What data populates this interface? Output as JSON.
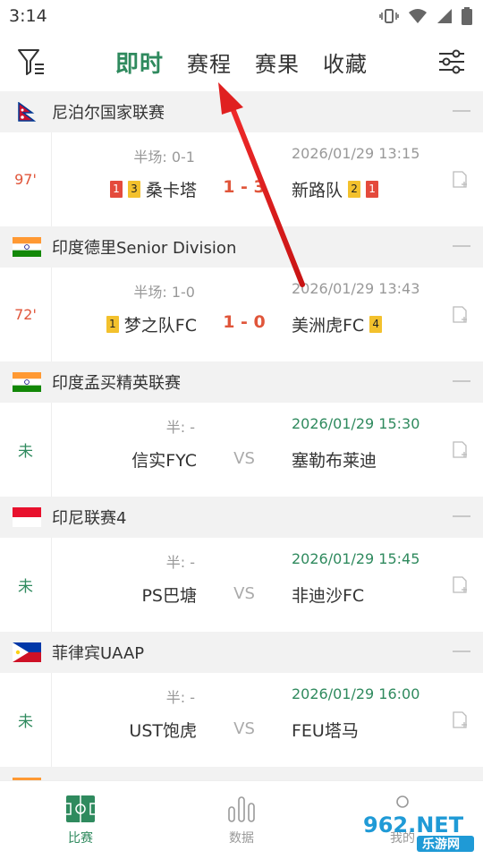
{
  "status": {
    "time": "3:14"
  },
  "header": {
    "tabs": [
      {
        "label": "即时",
        "active": true
      },
      {
        "label": "赛程",
        "active": false
      },
      {
        "label": "赛果",
        "active": false
      },
      {
        "label": "收藏",
        "active": false
      }
    ]
  },
  "leagues": [
    {
      "name": "尼泊尔国家联赛",
      "match": {
        "status": "97'",
        "half": "半场: 0-1",
        "date": "2026/01/29 13:15",
        "home": "桑卡塔",
        "home_cards": [
          "1",
          "3"
        ],
        "score": "1 - 3",
        "away": "新路队",
        "away_cards": [
          "2",
          "1"
        ]
      }
    },
    {
      "name": "印度德里Senior Division",
      "match": {
        "status": "72'",
        "half": "半场: 1-0",
        "date": "2026/01/29 13:43",
        "home": "梦之队FC",
        "home_cards": [
          "1"
        ],
        "score": "1 - 0",
        "away": "美洲虎FC",
        "away_cards": [
          "4"
        ]
      }
    },
    {
      "name": "印度孟买精英联赛",
      "match": {
        "status": "未",
        "half": "半: -",
        "date": "2026/01/29 15:30",
        "home": "信实FYC",
        "vs": "VS",
        "away": "塞勒布莱迪"
      }
    },
    {
      "name": "印尼联赛4",
      "match": {
        "status": "未",
        "half": "半: -",
        "date": "2026/01/29 15:45",
        "home": "PS巴塘",
        "vs": "VS",
        "away": "非迪沙FC"
      }
    },
    {
      "name": "菲律宾UAAP",
      "match": {
        "status": "未",
        "half": "半: -",
        "date": "2026/01/29 16:00",
        "home": "UST饱虎",
        "vs": "VS",
        "away": "FEU塔马"
      }
    }
  ],
  "bottom_nav": [
    {
      "label": "比赛",
      "icon": "soccer-field-icon",
      "active": true
    },
    {
      "label": "数据",
      "icon": "bar-chart-icon",
      "active": false
    },
    {
      "label": "我的",
      "icon": "person-icon",
      "active": false
    }
  ],
  "watermark": {
    "text": "962.NET",
    "sub": "乐游网"
  },
  "colors": {
    "accent": "#2f8a5e",
    "live": "#e0553a",
    "arrow": "#e02020"
  }
}
